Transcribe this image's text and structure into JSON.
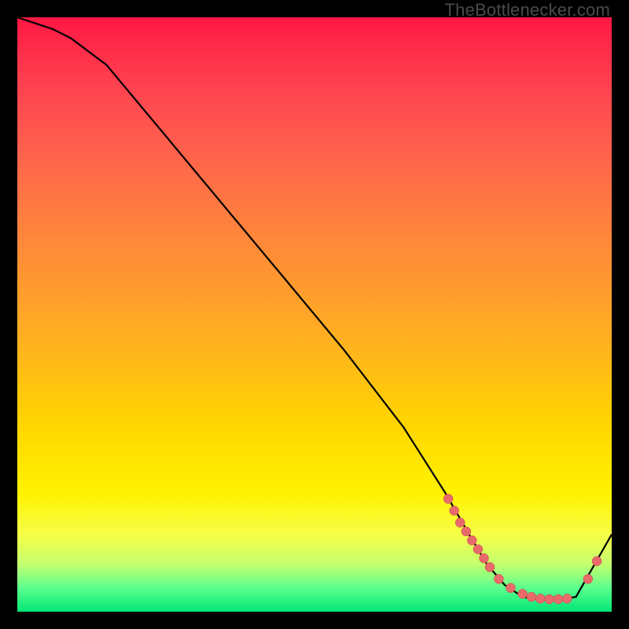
{
  "watermark": "TheBottlenecker.com",
  "colors": {
    "curve_stroke": "#000000",
    "marker_fill": "#e86a6a",
    "marker_stroke": "#c24a4a"
  },
  "chart_data": {
    "type": "line",
    "title": "",
    "xlabel": "",
    "ylabel": "",
    "xlim": [
      0,
      100
    ],
    "ylim": [
      0,
      100
    ],
    "x": [
      0,
      3,
      6,
      9,
      15,
      25,
      35,
      45,
      55,
      65,
      72,
      76,
      79,
      82,
      85,
      88,
      91,
      94,
      100
    ],
    "values": [
      100,
      99,
      98,
      96.5,
      92,
      80,
      68,
      56,
      44,
      31,
      20,
      13,
      8,
      4.5,
      2.5,
      2,
      2,
      2.5,
      13
    ],
    "markers": [
      {
        "x": 72.5,
        "y": 19
      },
      {
        "x": 73.5,
        "y": 17
      },
      {
        "x": 74.5,
        "y": 15
      },
      {
        "x": 75.5,
        "y": 13.5
      },
      {
        "x": 76.5,
        "y": 12
      },
      {
        "x": 77.5,
        "y": 10.5
      },
      {
        "x": 78.5,
        "y": 9
      },
      {
        "x": 79.5,
        "y": 7.5
      },
      {
        "x": 81,
        "y": 5.5
      },
      {
        "x": 83,
        "y": 4
      },
      {
        "x": 85,
        "y": 3
      },
      {
        "x": 86.5,
        "y": 2.5
      },
      {
        "x": 88,
        "y": 2.2
      },
      {
        "x": 89.5,
        "y": 2.1
      },
      {
        "x": 91,
        "y": 2.1
      },
      {
        "x": 92.5,
        "y": 2.2
      },
      {
        "x": 96,
        "y": 5.5
      },
      {
        "x": 97.5,
        "y": 8.5
      }
    ]
  }
}
